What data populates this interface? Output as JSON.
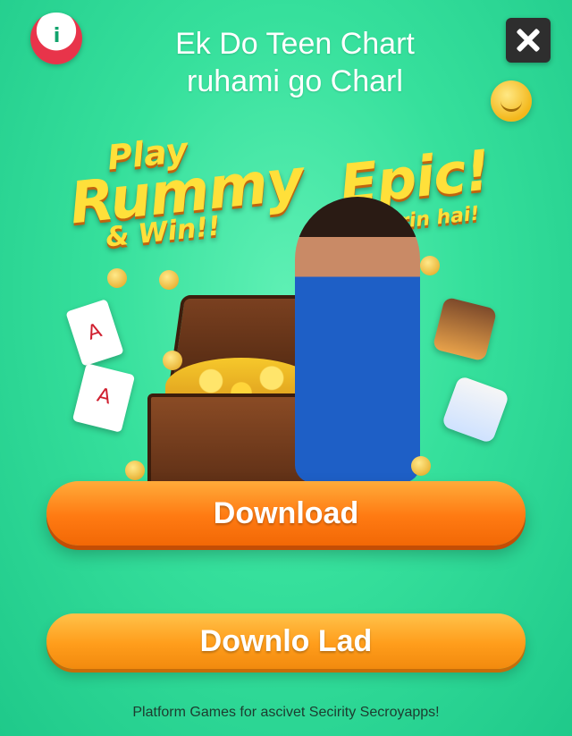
{
  "header": {
    "logo_text": "i",
    "title_line1": "Ek Do Teen Chart",
    "title_line2": "ruhami go Charl"
  },
  "promo": {
    "play": "Play",
    "rummy": "Rummy",
    "epic": "Epic!",
    "win": "& Win!!",
    "arin": "arin hai!"
  },
  "cards": {
    "card1": "A",
    "card2": "A"
  },
  "buttons": {
    "download_label": "Download",
    "download2_label": "Downlo Lad"
  },
  "footer": {
    "text": "Platform Games for ascivet Secirity Secroyapps!"
  },
  "colors": {
    "background": "#36e09c",
    "button_orange": "#ff7a12",
    "promo_yellow": "#ffe03a"
  }
}
